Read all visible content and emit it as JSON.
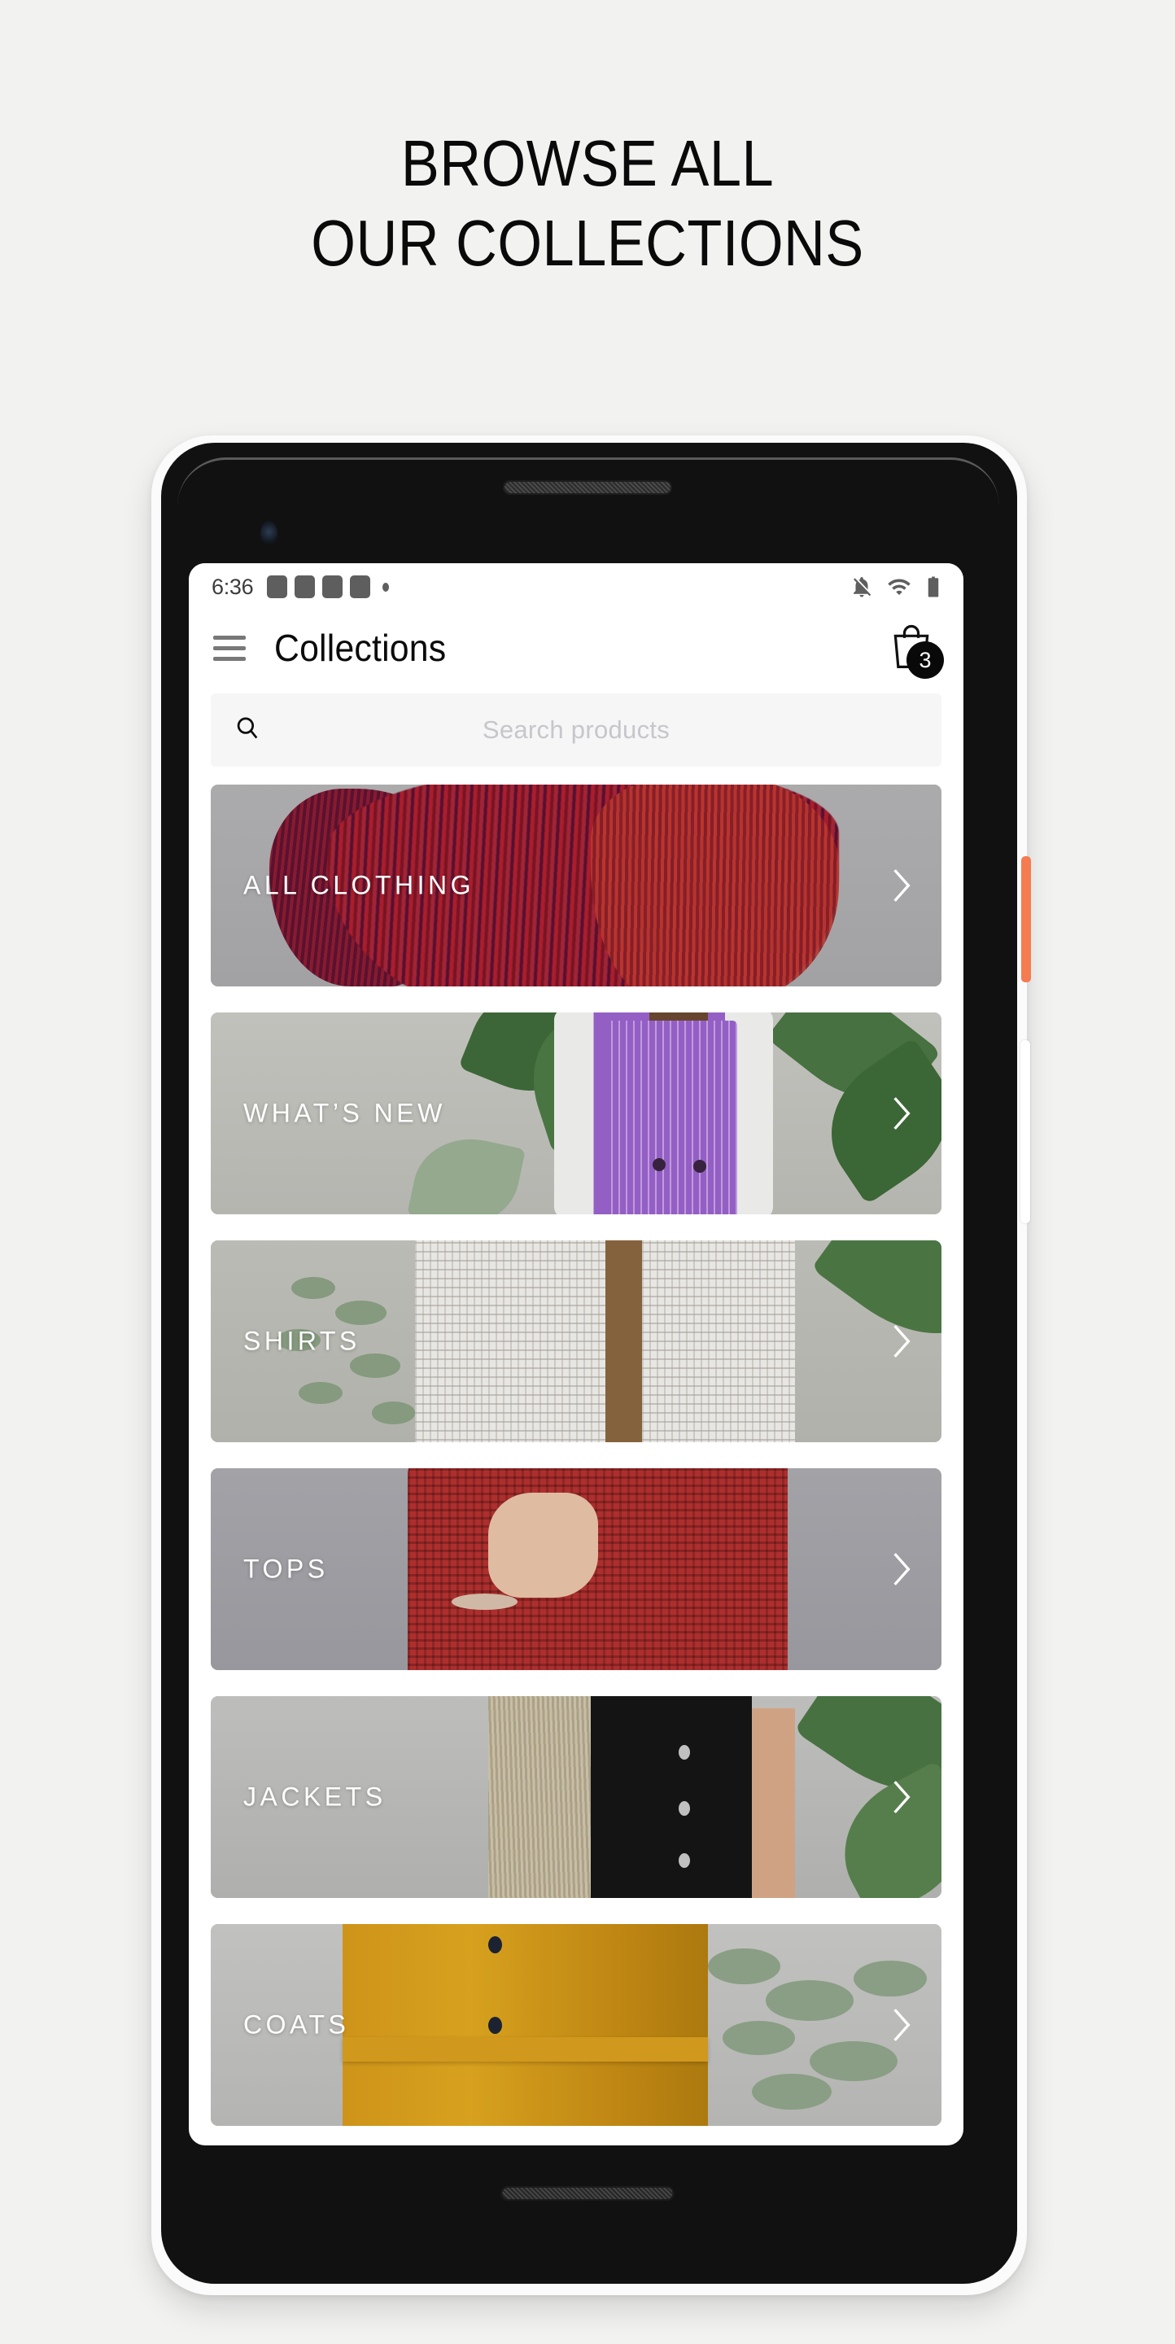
{
  "page": {
    "heading_line1": "BROWSE ALL",
    "heading_line2": "OUR COLLECTIONS",
    "background_color": "#f2f2f1"
  },
  "device": {
    "frame_color": "#fbfbfb",
    "body_color": "#111111",
    "power_button_color": "#f57b51",
    "volume_button_color": "#ffffff"
  },
  "status_bar": {
    "time": "6:36",
    "notification_icons": [
      "notification-square",
      "notification-square",
      "notification-square",
      "notification-square",
      "notification-dot"
    ],
    "right_icons": [
      "notifications-off-icon",
      "wifi-icon",
      "battery-icon"
    ],
    "icon_color": "#5e5e5e"
  },
  "app_bar": {
    "menu_icon": "hamburger-menu-icon",
    "title": "Collections",
    "cart_icon": "shopping-bag-icon",
    "cart_badge_count": "3",
    "badge_color": "#090909"
  },
  "search": {
    "icon": "search-icon",
    "placeholder": "Search products",
    "value": "",
    "background_color": "#f6f6f6"
  },
  "collections": [
    {
      "label": "ALL CLOTHING",
      "chevron": "chevron-right-icon",
      "photo": "red-fringe-jacket"
    },
    {
      "label": "WHAT’S NEW",
      "chevron": "chevron-right-icon",
      "photo": "purple-striped-vest"
    },
    {
      "label": "SHIRTS",
      "chevron": "chevron-right-icon",
      "photo": "white-lace-shirt"
    },
    {
      "label": "TOPS",
      "chevron": "chevron-right-icon",
      "photo": "red-knit-top"
    },
    {
      "label": "JACKETS",
      "chevron": "chevron-right-icon",
      "photo": "black-fringe-jacket"
    },
    {
      "label": "COATS",
      "chevron": "chevron-right-icon",
      "photo": "yellow-belted-coat"
    }
  ]
}
